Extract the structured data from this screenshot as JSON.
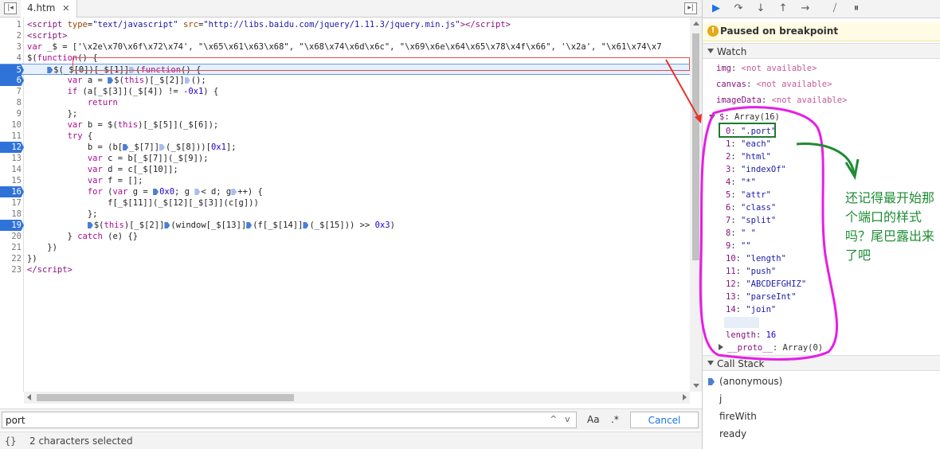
{
  "editor": {
    "tab": {
      "file_name": "4.htm",
      "close_glyph": "✕"
    },
    "lines": [
      {
        "n": "1",
        "html": "<span class='tag'>&lt;script</span> <span class='attr'>type</span>=<span class='str'>\"text/javascript\"</span> <span class='attr'>src</span>=<span class='str'>\"http://libs.baidu.com/jquery/1.11.3/jquery.min.js\"</span><span class='tag'>&gt;&lt;/script&gt;</span>"
      },
      {
        "n": "2",
        "html": "<span class='tag'>&lt;script&gt;</span>"
      },
      {
        "n": "3",
        "html": "<span class='kw'>var</span> _$ = ['\\x2e\\x70\\x6f\\x72\\x74', \"\\x65\\x61\\x63\\x68\", \"\\x68\\x74\\x6d\\x6c\", \"\\x69\\x6e\\x64\\x65\\x78\\x4f\\x66\", '\\x2a', \"\\x61\\x74\\x7"
      },
      {
        "n": "4",
        "html": "$(<span class='kw'>function</span>() {"
      },
      {
        "n": "5",
        "bp": true,
        "hl": true,
        "html": "    <span class='mk'></span>$(_$[0])[_$[1]]<span class='mk pale'></span>(<span class='kw'>function</span>() {"
      },
      {
        "n": "6",
        "bp": true,
        "html": "        <span class='kw'>var</span> a = <span class='mk'></span>$(<span class='kw'>this</span>)[_$[2]]<span class='mk pale'></span>();"
      },
      {
        "n": "7",
        "html": "        <span class='kw'>if</span> (a[_$[3]](_$[4]) != -<span class='num'>0x1</span>) {"
      },
      {
        "n": "8",
        "html": "            <span class='kw'>return</span>"
      },
      {
        "n": "9",
        "html": "        };"
      },
      {
        "n": "10",
        "html": "        <span class='kw'>var</span> b = $(<span class='kw'>this</span>)[_$[5]](_$[6]);"
      },
      {
        "n": "11",
        "html": "        <span class='kw'>try</span> {"
      },
      {
        "n": "12",
        "bp": true,
        "html": "            b = (b[<span class='mk'></span>_$[7]]<span class='mk pale'></span>(_$[8]))[<span class='num'>0x1</span>];"
      },
      {
        "n": "13",
        "html": "            <span class='kw'>var</span> c = b[_$[7]](_$[9]);"
      },
      {
        "n": "14",
        "html": "            <span class='kw'>var</span> d = c[_$[10]];"
      },
      {
        "n": "15",
        "html": "            <span class='kw'>var</span> f = [];"
      },
      {
        "n": "16",
        "bp": true,
        "html": "            <span class='kw'>for</span> (<span class='kw'>var</span> g = <span class='mk'></span><span class='num'>0x0</span>; g <span class='mk pale'></span>&lt; d; g<span class='mk pale'></span>++) {"
      },
      {
        "n": "17",
        "html": "                f[_$[11]](_$[12][_$[3]](c[g]))"
      },
      {
        "n": "18",
        "html": "            };"
      },
      {
        "n": "19",
        "bp": true,
        "html": "            <span class='mk'></span>$(<span class='kw'>this</span>)[_$[2]]<span class='mk'></span>(window[_$[13]]<span class='mk'></span>(f[_$[14]]<span class='mk'></span>(_$[15])) &gt;&gt; <span class='num'>0x3</span>)"
      },
      {
        "n": "20",
        "html": "        } <span class='kw'>catch</span> (e) {}"
      },
      {
        "n": "21",
        "html": "    })"
      },
      {
        "n": "22",
        "html": "})"
      },
      {
        "n": "23",
        "html": "<span class='tag'>&lt;/script&gt;</span>"
      }
    ]
  },
  "search": {
    "value": "port",
    "up_glyph": "^",
    "down_glyph": "v",
    "match_case_label": "Aa",
    "regex_label": ".*",
    "cancel_label": "Cancel"
  },
  "status": {
    "braces": "{}",
    "text": "2 characters selected"
  },
  "debugger": {
    "paused_text": "Paused on breakpoint",
    "watch_title": "Watch",
    "watch_na": [
      {
        "name": "img",
        "value": "<not available>"
      },
      {
        "name": "canvas",
        "value": "<not available>"
      },
      {
        "name": "imageData",
        "value": "<not available>"
      }
    ],
    "array_name": "$",
    "array_summary": "Array(16)",
    "array_items": [
      {
        "idx": "0",
        "val": "\".port\""
      },
      {
        "idx": "1",
        "val": "\"each\""
      },
      {
        "idx": "2",
        "val": "\"html\""
      },
      {
        "idx": "3",
        "val": "\"indexOf\""
      },
      {
        "idx": "4",
        "val": "\"*\""
      },
      {
        "idx": "5",
        "val": "\"attr\""
      },
      {
        "idx": "6",
        "val": "\"class\""
      },
      {
        "idx": "7",
        "val": "\"split\""
      },
      {
        "idx": "8",
        "val": "\" \""
      },
      {
        "idx": "9",
        "val": "\"\""
      },
      {
        "idx": "10",
        "val": "\"length\""
      },
      {
        "idx": "11",
        "val": "\"push\""
      },
      {
        "idx": "12",
        "val": "\"ABCDEFGHIZ\""
      },
      {
        "idx": "13",
        "val": "\"parseInt\""
      },
      {
        "idx": "14",
        "val": "\"join\""
      },
      {
        "idx": "15",
        "val": "\"\""
      }
    ],
    "length_label": "length",
    "length_value": "16",
    "proto_label": "__proto__",
    "proto_value": "Array(0)",
    "callstack_title": "Call Stack",
    "callstack": [
      "(anonymous)",
      "j",
      "fireWith",
      "ready"
    ]
  },
  "annotation": {
    "text": "还记得最开始那个端口的样式吗？尾巴露出来了吧"
  },
  "colors": {
    "highlight_box": "#d9534f",
    "annotation_green": "#1e8c34",
    "annotation_magenta": "#e61ee6",
    "arrow_red": "#e8322a",
    "breakpoint_blue": "#2f73d8"
  }
}
